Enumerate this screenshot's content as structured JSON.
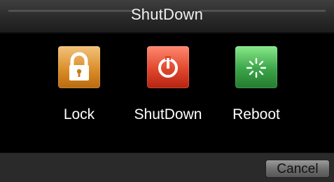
{
  "dialog": {
    "title": "ShutDown"
  },
  "actions": [
    {
      "label": "Lock",
      "icon": "lock-icon",
      "color": "#d98a25"
    },
    {
      "label": "ShutDown",
      "icon": "power-icon",
      "color": "#e0472d"
    },
    {
      "label": "Reboot",
      "icon": "reboot-icon",
      "color": "#3aa548"
    }
  ],
  "footer": {
    "cancel_label": "Cancel"
  }
}
